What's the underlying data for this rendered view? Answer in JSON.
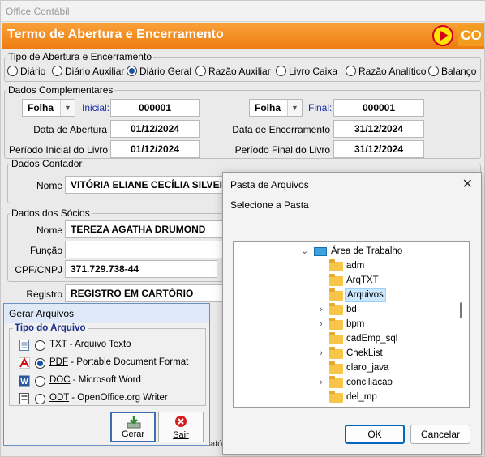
{
  "window": {
    "title": "Office Contábil"
  },
  "banner": {
    "title": "Termo de Abertura e Encerramento",
    "logo_text": "CO"
  },
  "tipo": {
    "legend": "Tipo de Abertura e Encerramento",
    "options": [
      "Diário",
      "Diário Auxiliar",
      "Diário Geral",
      "Razão Auxiliar",
      "Livro Caixa",
      "Razão Analítico",
      "Balanço"
    ],
    "selected": "Diário Geral"
  },
  "complementares": {
    "legend": "Dados Complementares",
    "left_type": "Folha",
    "right_type": "Folha",
    "inicial_label": "Inicial:",
    "inicial_value": "000001",
    "final_label": "Final:",
    "final_value": "000001",
    "data_abertura_label": "Data de Abertura",
    "data_abertura": "01/12/2024",
    "data_encerramento_label": "Data de Encerramento",
    "data_encerramento": "31/12/2024",
    "periodo_inicial_label": "Período Inicial do Livro",
    "periodo_inicial": "01/12/2024",
    "periodo_final_label": "Período Final do Livro",
    "periodo_final": "31/12/2024"
  },
  "contador": {
    "legend": "Dados Contador",
    "nome_label": "Nome",
    "nome": "VITÓRIA ELIANE CECÍLIA SILVEIRA"
  },
  "socios": {
    "legend": "Dados dos Sócios",
    "nome_label": "Nome",
    "nome": "TEREZA AGATHA DRUMOND",
    "funcao_label": "Função",
    "funcao": "",
    "cpf_label": "CPF/CNPJ",
    "cpf": "371.729.738-44"
  },
  "registro": {
    "label": "Registro",
    "value": "REGISTRO EM CARTÓRIO"
  },
  "partial_bottom_text": "atór",
  "folder_dialog": {
    "title": "Pasta de Arquivos",
    "prompt": "Selecione a Pasta",
    "root": "Área de Trabalho",
    "folders": [
      "adm",
      "ArqTXT",
      "Arquivos",
      "bd",
      "bpm",
      "cadEmp_sql",
      "ChekList",
      "claro_java",
      "conciliacao",
      "del_mp"
    ],
    "selected": "Arquivos",
    "ok": "OK",
    "cancel": "Cancelar"
  },
  "gerar_dialog": {
    "title": "Gerar Arquivos",
    "legend": "Tipo do Arquivo",
    "types": [
      {
        "code": "TXT",
        "desc": "- Arquivo Texto"
      },
      {
        "code": "PDF",
        "desc": "- Portable Document Format"
      },
      {
        "code": "DOC",
        "desc": "- Microsoft Word"
      },
      {
        "code": "ODT",
        "desc": "- OpenOffice.org Writer"
      }
    ],
    "selected": "PDF",
    "gerar": "Gerar",
    "sair": "Sair"
  }
}
